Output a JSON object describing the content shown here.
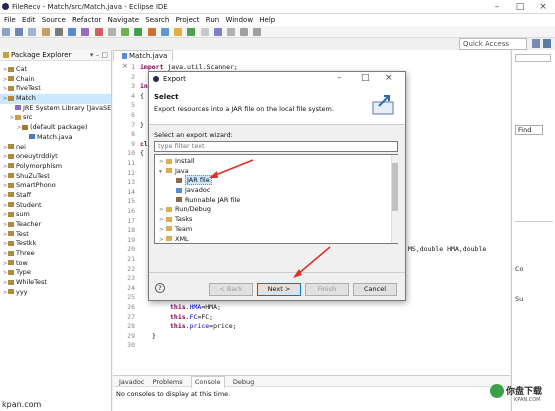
{
  "window": {
    "title": "FileRecv - Match/src/Match.java - Eclipse IDE"
  },
  "menu": [
    "File",
    "Edit",
    "Source",
    "Refactor",
    "Navigate",
    "Search",
    "Project",
    "Run",
    "Window",
    "Help"
  ],
  "quick_access": "Quick Access",
  "package_explorer": {
    "title": "Package Explorer",
    "items": [
      {
        "label": "Cat",
        "indent": 0,
        "kind": "project"
      },
      {
        "label": "Chain",
        "indent": 0,
        "kind": "project"
      },
      {
        "label": "fiveTest",
        "indent": 0,
        "kind": "project"
      },
      {
        "label": "Match",
        "indent": 0,
        "kind": "project",
        "selected": true
      },
      {
        "label": "JRE System Library [JavaSE",
        "indent": 1,
        "kind": "lib"
      },
      {
        "label": "src",
        "indent": 1,
        "kind": "folder"
      },
      {
        "label": "(default package)",
        "indent": 2,
        "kind": "package"
      },
      {
        "label": "Match.java",
        "indent": 3,
        "kind": "java"
      },
      {
        "label": "nei",
        "indent": 0,
        "kind": "project"
      },
      {
        "label": "oneuytrddiyt",
        "indent": 0,
        "kind": "project"
      },
      {
        "label": "Polymorphism",
        "indent": 0,
        "kind": "project"
      },
      {
        "label": "ShuZuTest",
        "indent": 0,
        "kind": "project"
      },
      {
        "label": "SmartPhono",
        "indent": 0,
        "kind": "project"
      },
      {
        "label": "Staff",
        "indent": 0,
        "kind": "project"
      },
      {
        "label": "Student",
        "indent": 0,
        "kind": "project"
      },
      {
        "label": "sum",
        "indent": 0,
        "kind": "project"
      },
      {
        "label": "Teacher",
        "indent": 0,
        "kind": "project"
      },
      {
        "label": "Test",
        "indent": 0,
        "kind": "project"
      },
      {
        "label": "Testkk",
        "indent": 0,
        "kind": "project"
      },
      {
        "label": "Three",
        "indent": 0,
        "kind": "project"
      },
      {
        "label": "tow",
        "indent": 0,
        "kind": "project"
      },
      {
        "label": "Type",
        "indent": 0,
        "kind": "project"
      },
      {
        "label": "WhileTest",
        "indent": 0,
        "kind": "project"
      },
      {
        "label": "yyy",
        "indent": 0,
        "kind": "project"
      }
    ]
  },
  "editor": {
    "tab": "Match.java",
    "lines": [
      {
        "n": "1",
        "text": "import java.util.Scanner;"
      },
      {
        "n": "2",
        "text": ""
      },
      {
        "n": "3",
        "text": "inte"
      },
      {
        "n": "4",
        "text": "{"
      },
      {
        "n": "5",
        "text": ""
      },
      {
        "n": "6",
        "text": ""
      },
      {
        "n": "7",
        "text": "}"
      },
      {
        "n": "8",
        "text": ""
      },
      {
        "n": "9",
        "text": "clas"
      },
      {
        "n": "10",
        "text": "{"
      },
      {
        "n": "11",
        "text": ""
      },
      {
        "n": "12",
        "text": ""
      },
      {
        "n": "13",
        "text": ""
      },
      {
        "n": "14",
        "text": ""
      },
      {
        "n": "15",
        "text": ""
      },
      {
        "n": "16",
        "text": ""
      },
      {
        "n": "17",
        "text": ""
      },
      {
        "n": "18",
        "text": ""
      },
      {
        "n": "19",
        "text": ""
      },
      {
        "n": "20",
        "text": "MS,double HMA,double"
      },
      {
        "n": "21",
        "text": ""
      },
      {
        "n": "22",
        "text": ""
      },
      {
        "n": "23",
        "text": ""
      },
      {
        "n": "24",
        "text": ""
      },
      {
        "n": "25",
        "text": "this.MS=MS;"
      },
      {
        "n": "26",
        "text": "this.HMA=HMA;"
      },
      {
        "n": "27",
        "text": "this.FC=FC;"
      },
      {
        "n": "28",
        "text": "this.price=price;"
      },
      {
        "n": "29",
        "text": "}"
      },
      {
        "n": "30",
        "text": ""
      }
    ]
  },
  "bottom_tabs": [
    "Javadoc",
    "Problems",
    "Console",
    "Debug"
  ],
  "console_text": "No consoles to display at this time.",
  "right_panel": {
    "find": "Find",
    "items": [
      "Co",
      "Su"
    ]
  },
  "dialog": {
    "title": "Export",
    "heading": "Select",
    "description": "Export resources into a JAR file on the local file system.",
    "wizard_label": "Select an export wizard:",
    "filter_placeholder": "type filter text",
    "tree": [
      {
        "label": "Install",
        "indent": 0,
        "kind": "folder",
        "expand": ">"
      },
      {
        "label": "Java",
        "indent": 0,
        "kind": "folder",
        "expand": "v"
      },
      {
        "label": "JAR file",
        "indent": 1,
        "kind": "jar",
        "selected": true
      },
      {
        "label": "Javadoc",
        "indent": 1,
        "kind": "doc"
      },
      {
        "label": "Runnable JAR file",
        "indent": 1,
        "kind": "jar"
      },
      {
        "label": "Run/Debug",
        "indent": 0,
        "kind": "folder",
        "expand": ">"
      },
      {
        "label": "Tasks",
        "indent": 0,
        "kind": "folder",
        "expand": ">"
      },
      {
        "label": "Team",
        "indent": 0,
        "kind": "folder",
        "expand": ">"
      },
      {
        "label": "XML",
        "indent": 0,
        "kind": "folder",
        "expand": ">"
      }
    ],
    "buttons": {
      "back": "< Back",
      "next": "Next >",
      "finish": "Finish",
      "cancel": "Cancel"
    },
    "help": "?"
  },
  "watermark": {
    "left": "kpan.com",
    "right": "你盘下载",
    "sub": "KPAN.COM"
  },
  "colors": {
    "accent": "#0078d7",
    "arrow": "#e0322b",
    "selection": "#cce8ff"
  }
}
